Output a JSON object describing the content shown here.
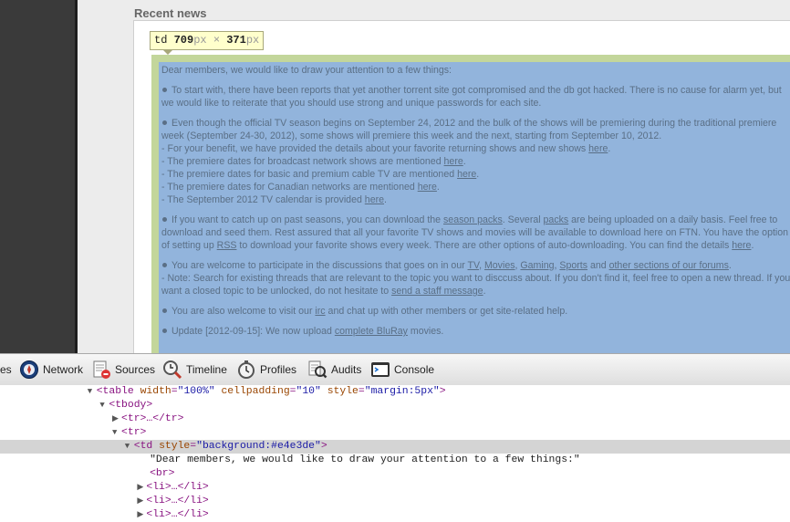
{
  "page": {
    "section_title": "Recent news",
    "tooltip": {
      "tag": "td",
      "width": "709",
      "width_unit": "px",
      "times": "×",
      "height": "371",
      "height_unit": "px"
    },
    "news": {
      "intro": "Dear members, we would like to draw your attention to a few things:",
      "item1": "To start with, there have been reports that yet another torrent site got compromised and the db got hacked. There is no cause for alarm yet, but we would like to reiterate that you should use strong and unique passwords for each site.",
      "item2_main": "Even though the official TV season begins on September 24, 2012 and the bulk of the shows will be premiering during the traditional premiere week (September 24-30, 2012), some shows will premiere this week and the next, starting from September 10, 2012.",
      "item2_l1": "- For your benefit, we have provided the details about your favorite returning shows and new shows ",
      "item2_l2": "- The premiere dates for broadcast network shows are mentioned ",
      "item2_l3": "- The premiere dates for basic and premium cable TV are mentioned ",
      "item2_l4": "- The premiere dates for Canadian networks are mentioned ",
      "item2_l5": "- The September 2012 TV calendar is provided ",
      "here": "here",
      "item3_a": "If you want to catch up on past seasons, you can download the ",
      "season_packs": "season packs",
      "item3_b": ". Several ",
      "packs": "packs",
      "item3_c": " are being uploaded on a daily basis. Feel free to download and seed them. Rest assured that all your favorite TV shows and movies will be available to download here on FTN. You have the option of setting up ",
      "rss": "RSS",
      "item3_d": " to download your favorite shows every week. There are other options of auto-downloading. You can find the details ",
      "item4_a": "You are welcome to participate in the discussions that goes on in our ",
      "tv": "TV",
      "movies": "Movies",
      "gaming": "Gaming",
      "sports": "Sports",
      "and": " and ",
      "other_sections": "other sections of our forums",
      "item4_b": "- Note: Search for existing threads that are relevant to the topic you want to disccuss about. If you don't find it, feel free to open a new thread. If you want a closed topic to be unlocked, do not hesitate to ",
      "staff_message": "send a staff message",
      "item5_a": "You are also welcome to visit our ",
      "irc": "irc",
      "item5_b": " and chat up with other members or get site-related help.",
      "item6_a": "Update [2012-09-15]: We now upload ",
      "bluray": "complete BluRay",
      "item6_b": " movies."
    }
  },
  "toolbar": {
    "items": [
      {
        "label": "es",
        "icon": "elements-icon"
      },
      {
        "label": "Network",
        "icon": "network-icon"
      },
      {
        "label": "Sources",
        "icon": "sources-icon"
      },
      {
        "label": "Timeline",
        "icon": "timeline-icon"
      },
      {
        "label": "Profiles",
        "icon": "profiles-icon"
      },
      {
        "label": "Audits",
        "icon": "audits-icon"
      },
      {
        "label": "Console",
        "icon": "console-icon"
      }
    ]
  },
  "tree": {
    "r1": {
      "tag": "table",
      "a1n": "width",
      "a1v": "\"100%\"",
      "a2n": "cellpadding",
      "a2v": "\"10\"",
      "a3n": "style",
      "a3v": "\"margin:5px\""
    },
    "r2": "<tbody>",
    "r3": "<tr>…</tr>",
    "r4": "<tr>",
    "r5": {
      "tag": "td",
      "an": "style",
      "av": "\"background:#e4e3de\""
    },
    "r6": "\"Dear members, we would like to draw your attention to a few things:\"",
    "r7": "<br>",
    "r8": "<li>…</li>",
    "r9": "<li>…</li>",
    "r10": "<li>…</li>"
  },
  "colors": {
    "highlight_padding": "#c3d69b",
    "highlight_content": "#92b4dc",
    "selected_row": "#d4d4d4"
  }
}
